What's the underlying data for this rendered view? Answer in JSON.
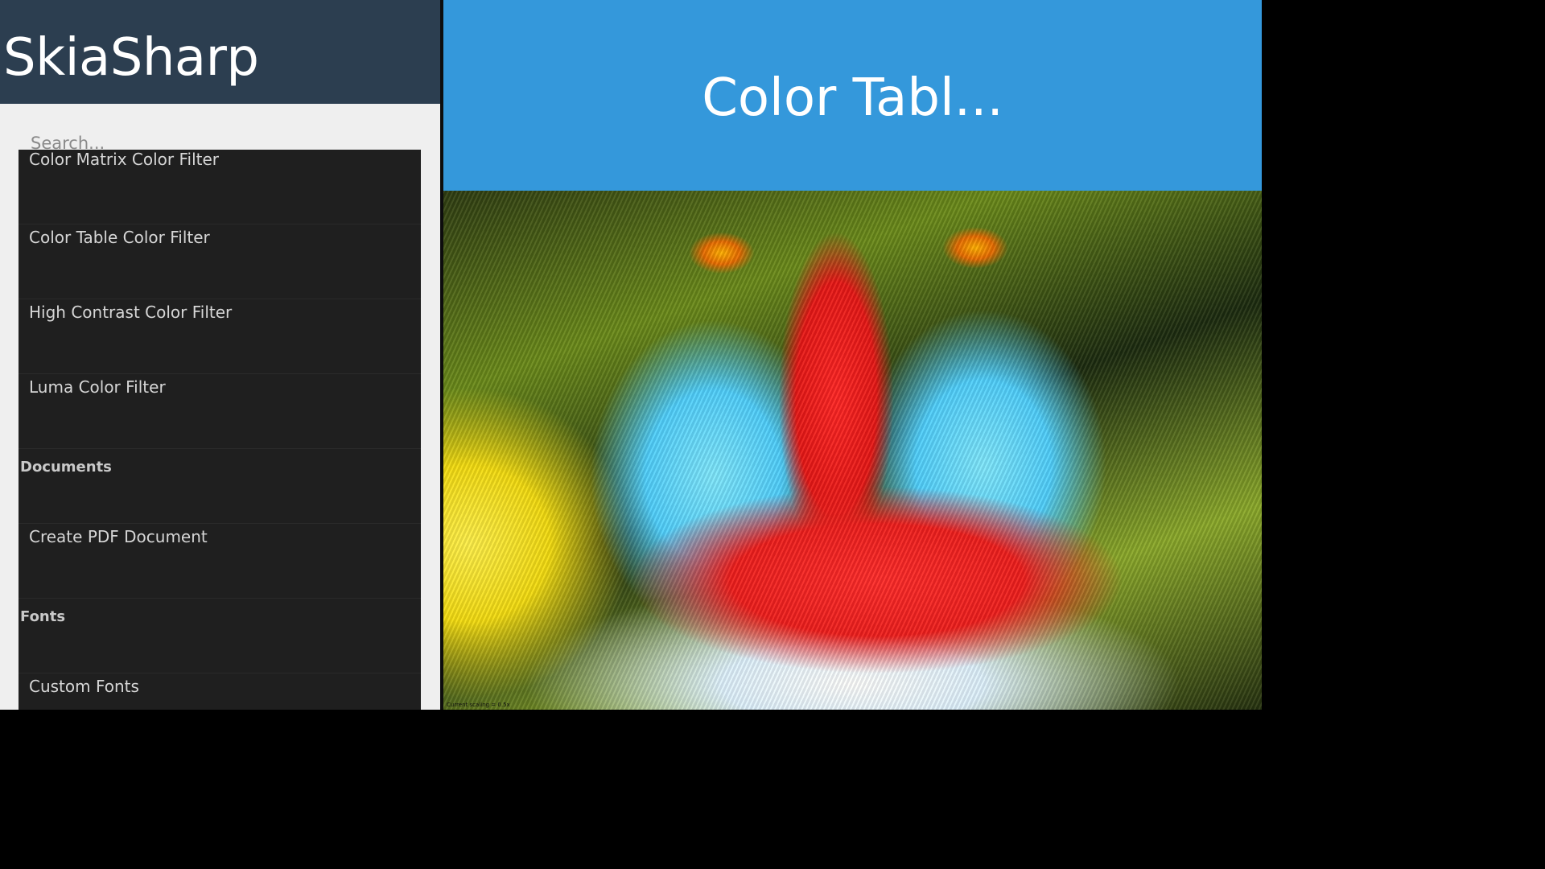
{
  "app": {
    "title": "SkiaSharp"
  },
  "search": {
    "placeholder": "Search..."
  },
  "list": [
    {
      "type": "item",
      "label": "Color Matrix Color Filter"
    },
    {
      "type": "item",
      "label": "Color Table Color Filter"
    },
    {
      "type": "item",
      "label": "High Contrast Color Filter"
    },
    {
      "type": "item",
      "label": "Luma Color Filter"
    },
    {
      "type": "header",
      "label": "Documents"
    },
    {
      "type": "item",
      "label": "Create PDF Document"
    },
    {
      "type": "header",
      "label": "Fonts"
    },
    {
      "type": "item",
      "label": "Custom Fonts"
    }
  ],
  "detail": {
    "title": "Color Tabl...",
    "scaling": "Current scaling = 0.5x"
  },
  "colors": {
    "sidebar_header": "#2c3e50",
    "detail_header": "#3498db",
    "list_background": "#1f1f1f"
  }
}
